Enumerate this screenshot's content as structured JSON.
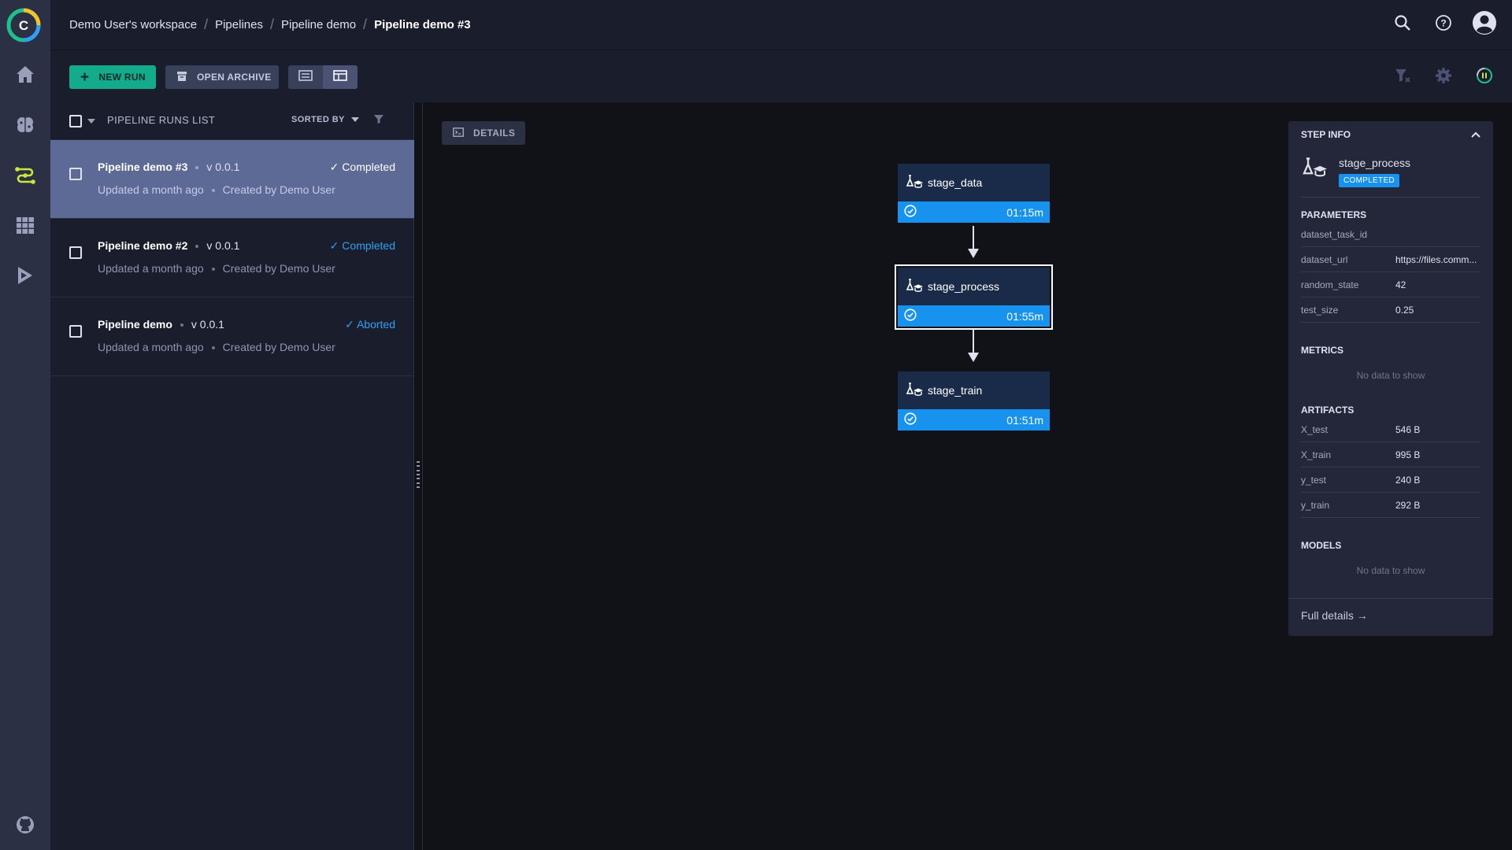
{
  "colors": {
    "accent_new_run": "#14aa8c",
    "status_blue": "#1793ef",
    "selected_row": "#5e6a96",
    "node_bg": "#1a2b4a"
  },
  "breadcrumbs": [
    "Demo User's workspace",
    "Pipelines",
    "Pipeline demo",
    "Pipeline demo #3"
  ],
  "header": {
    "icons": [
      "search-icon",
      "help-icon",
      "user-avatar-icon"
    ]
  },
  "sidebar": {
    "items": [
      {
        "name": "home",
        "icon": "home-icon"
      },
      {
        "name": "projects",
        "icon": "brain-icon"
      },
      {
        "name": "pipelines",
        "icon": "pipelines-icon",
        "active": true
      },
      {
        "name": "datasets",
        "icon": "datasets-icon"
      },
      {
        "name": "orchestration",
        "icon": "orchestration-icon"
      },
      {
        "name": "github",
        "icon": "github-icon"
      }
    ]
  },
  "toolbar": {
    "new_run_label": "NEW RUN",
    "open_archive_label": "OPEN ARCHIVE"
  },
  "runs_list": {
    "title": "PIPELINE RUNS LIST",
    "sorted_by_label": "SORTED BY",
    "rows": [
      {
        "name": "Pipeline demo #3",
        "version": "v 0.0.1",
        "updated": "Updated a month ago",
        "created": "Created by Demo User",
        "status": "Completed",
        "selected": true
      },
      {
        "name": "Pipeline demo #2",
        "version": "v 0.0.1",
        "updated": "Updated a month ago",
        "created": "Created by Demo User",
        "status": "Completed",
        "selected": false
      },
      {
        "name": "Pipeline demo",
        "version": "v 0.0.1",
        "updated": "Updated a month ago",
        "created": "Created by Demo User",
        "status": "Aborted",
        "selected": false
      }
    ]
  },
  "canvas": {
    "details_label": "DETAILS",
    "nodes": [
      {
        "name": "stage_data",
        "duration": "01:15m",
        "active": false
      },
      {
        "name": "stage_process",
        "duration": "01:55m",
        "active": true
      },
      {
        "name": "stage_train",
        "duration": "01:51m",
        "active": false
      }
    ]
  },
  "step_info": {
    "title": "STEP INFO",
    "step_name": "stage_process",
    "status_badge": "COMPLETED",
    "parameters_title": "PARAMETERS",
    "parameters": [
      {
        "key": "dataset_task_id",
        "value": ""
      },
      {
        "key": "dataset_url",
        "value": "https://files.comm..."
      },
      {
        "key": "random_state",
        "value": "42"
      },
      {
        "key": "test_size",
        "value": "0.25"
      }
    ],
    "metrics_title": "METRICS",
    "metrics_empty": "No data to show",
    "artifacts_title": "ARTIFACTS",
    "artifacts": [
      {
        "key": "X_test",
        "value": "546 B"
      },
      {
        "key": "X_train",
        "value": "995 B"
      },
      {
        "key": "y_test",
        "value": "240 B"
      },
      {
        "key": "y_train",
        "value": "292 B"
      }
    ],
    "models_title": "MODELS",
    "models_empty": "No data to show",
    "full_details_label": "Full details →"
  }
}
